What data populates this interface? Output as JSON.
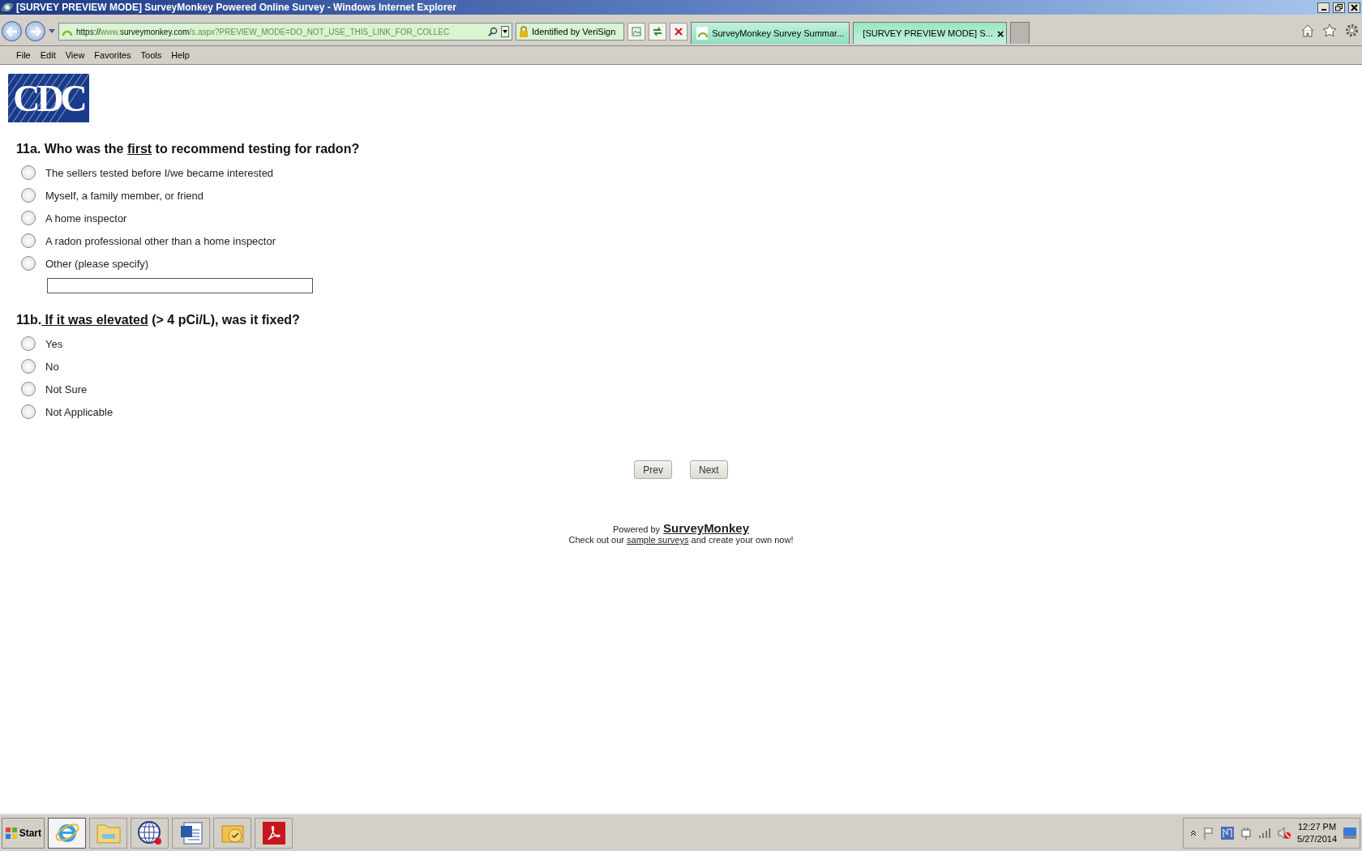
{
  "window": {
    "title": "[SURVEY PREVIEW MODE] SurveyMonkey Powered Online Survey - Windows Internet Explorer"
  },
  "address_bar": {
    "url_parts": [
      {
        "text": "https://",
        "emphasis": true
      },
      {
        "text": "www.",
        "emphasis": false
      },
      {
        "text": "surveymonkey.com",
        "emphasis": true
      },
      {
        "text": "/s.aspx?PREVIEW_MODE=DO_NOT_USE_THIS_LINK_FOR_COLLEC",
        "emphasis": false
      }
    ],
    "security": "Identified by VeriSign"
  },
  "tabs": [
    {
      "label": "SurveyMonkey Survey Summar...",
      "selected": false
    },
    {
      "label": "[SURVEY PREVIEW MODE] S...",
      "selected": true,
      "close": "×"
    }
  ],
  "menu": [
    "File",
    "Edit",
    "View",
    "Favorites",
    "Tools",
    "Help"
  ],
  "logo": "CDC",
  "questions": [
    {
      "title": [
        {
          "text": "11a. Who was the ",
          "underline": false
        },
        {
          "text": "first",
          "underline": true
        },
        {
          "text": " to recommend testing for radon?",
          "underline": false
        }
      ],
      "options": [
        {
          "label": "The sellers tested before I/we became interested",
          "selected": false
        },
        {
          "label": "Myself, a family member, or friend",
          "selected": false
        },
        {
          "label": "A home inspector",
          "selected": false
        },
        {
          "label": "A radon professional other than a home inspector",
          "selected": false
        },
        {
          "label": "Other (please specify)",
          "selected": false,
          "kind": "other"
        }
      ]
    },
    {
      "title": [
        {
          "text": "11b.",
          "underline": false
        },
        {
          "text": " If it was elevated",
          "underline": true
        },
        {
          "text": " (> 4 pCi/L), was it fixed?",
          "underline": false
        }
      ],
      "options": [
        {
          "label": "Yes",
          "selected": false
        },
        {
          "label": "No",
          "selected": false
        },
        {
          "label": "Not Sure",
          "selected": false
        },
        {
          "label": "Not Applicable",
          "selected": false
        }
      ]
    }
  ],
  "buttons": [
    "Prev",
    "Next"
  ],
  "footer": {
    "powered_by": "Powered by",
    "brand": "SurveyMonkey",
    "before_link": "Check out our ",
    "link": "sample surveys",
    "after_link": " and create your own now!"
  },
  "taskbar": {
    "start": "Start",
    "apps": [
      {
        "kind": "ie",
        "selected": true
      },
      {
        "kind": "folder",
        "selected": false
      },
      {
        "kind": "globe",
        "selected": false
      },
      {
        "kind": "word",
        "selected": false
      },
      {
        "kind": "mail",
        "selected": false
      },
      {
        "kind": "pdf",
        "selected": false
      }
    ],
    "time": "12:27 PM",
    "date": "5/27/2014"
  }
}
